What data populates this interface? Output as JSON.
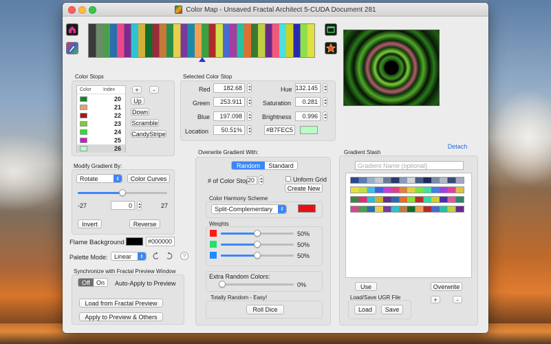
{
  "window": {
    "title": "Color Map - Unsaved Fractal Architect 5-CUDA Document 281"
  },
  "icons": {
    "home": "house-icon",
    "picker": "color-picker-icon",
    "window": "window-icon",
    "favorite": "star-icon",
    "undo": "undo-icon",
    "redo": "redo-icon",
    "help": "help-icon"
  },
  "gradient": {
    "colors": [
      "#3a3a3a",
      "#6a8a6a",
      "#4aa04a",
      "#2a6fb0",
      "#e94a8a",
      "#7b2c8c",
      "#2cc4d0",
      "#d4b03a",
      "#0e6e2a",
      "#9a2a3a",
      "#c47a3a",
      "#2a8e4a",
      "#e8d04a",
      "#7a3a9a",
      "#1a8aa8",
      "#f0a050",
      "#3aa040",
      "#b02a2a",
      "#d0e04a",
      "#4a6ad0",
      "#a040a0",
      "#28c0a0",
      "#e07030",
      "#3a7a30",
      "#c0d040",
      "#6a2a8a",
      "#f05a7a",
      "#4ae0e0",
      "#d0d020",
      "#2a2ab0",
      "#8ee04a",
      "#e0e040"
    ]
  },
  "color_stops": {
    "title": "Color Stops",
    "headers": [
      "Color",
      "Index"
    ],
    "rows": [
      {
        "color": "#0a8a2a",
        "index": "20"
      },
      {
        "color": "#e8a070",
        "index": "21"
      },
      {
        "color": "#a01a1a",
        "index": "22"
      },
      {
        "color": "#7ad030",
        "index": "23"
      },
      {
        "color": "#28e028",
        "index": "24"
      },
      {
        "color": "#c020c0",
        "index": "25"
      },
      {
        "color": "#b7fec5",
        "index": "26"
      }
    ],
    "plus": "+",
    "minus": "-",
    "up": "Up",
    "down": "Down",
    "scramble": "Scramble",
    "candystripe": "CandyStripe"
  },
  "selected_stop": {
    "title": "Selected Color Stop",
    "red_label": "Red",
    "red": "182.68",
    "green_label": "Green",
    "green": "253.911",
    "blue_label": "Blue",
    "blue": "197.098",
    "location_label": "Location",
    "location": "50.51%",
    "hue_label": "Hue",
    "hue": "132.145",
    "saturation_label": "Saturation",
    "saturation": "0.281",
    "brightness_label": "Brightness",
    "brightness": "0.996",
    "hex": "#B7FEC5",
    "swatch": "#b7fec5"
  },
  "modify": {
    "title": "Modify Gradient By:",
    "mode": "Rotate",
    "color_curves": "Color Curves",
    "slider_fraction": 0.5,
    "min": "-27",
    "value": "0",
    "max": "27",
    "invert": "Invert",
    "reverse": "Reverse"
  },
  "flame": {
    "label": "Flame Background",
    "hex": "#000000",
    "swatch": "#000000"
  },
  "palette": {
    "label": "Palette Mode:",
    "mode": "Linear",
    "help": "?"
  },
  "sync": {
    "title": "Synchronize with Fractal Preview Window",
    "off": "Off",
    "on": "On",
    "auto_apply": "Auto-Apply to Preview",
    "load": "Load from Fractal Preview",
    "apply": "Apply to Preview & Others"
  },
  "overwrite": {
    "title": "Overwrite Gradient With:",
    "tab_random": "Random",
    "tab_standard": "Standard",
    "num_stops_label": "# of Color Stops",
    "num_stops": "20",
    "uniform_grid": "Unform Grid",
    "create_new": "Create New",
    "harmony_label": "Color Harmony Scheme",
    "harmony": "Split-Complementary",
    "harmony_color": "#e81010",
    "weights_label": "Weights",
    "weights": [
      {
        "color": "#ff1a1a",
        "value": "50%",
        "fraction": 0.5
      },
      {
        "color": "#22e070",
        "value": "50%",
        "fraction": 0.5
      },
      {
        "color": "#1e8cff",
        "value": "50%",
        "fraction": 0.5
      }
    ],
    "extra_label": "Extra Random Colors:",
    "extra_value": "0%",
    "extra_fraction": 0,
    "easy_label": "Totally Random - Easy!",
    "roll": "Roll Dice"
  },
  "stash": {
    "detach": "Detach",
    "title": "Gradient Stash",
    "placeholder": "Gradient Name (optional)",
    "gradients": [
      [
        "#2a4a8a",
        "#5a7ab0",
        "#9ab0c8",
        "#c0c8d0",
        "#6a7a9a",
        "#2a3a6a",
        "#8a9ab8",
        "#d0d4dc",
        "#4a5a8a",
        "#1a2a5a",
        "#7a8aaa",
        "#b0b8c8",
        "#3a4a7a",
        "#a0a8c0"
      ],
      [
        "#e8e040",
        "#c0e040",
        "#40c0e0",
        "#4060e0",
        "#c040e0",
        "#e04080",
        "#e08040",
        "#e0d040",
        "#80e040",
        "#40e0a0",
        "#4080e0",
        "#a040e0",
        "#e040a0",
        "#e0c040"
      ],
      [
        "#3a8a3a",
        "#e02a7a",
        "#2ac0d0",
        "#d0b02a",
        "#6a2a8a",
        "#2a6ab0",
        "#e0702a",
        "#8ae02a",
        "#c02a2a",
        "#2ae0a0",
        "#d0d02a",
        "#4a2ab0",
        "#e05a9a",
        "#2a8a6a"
      ],
      [
        "#d04a8a",
        "#4aa04a",
        "#2a6fb0",
        "#e8d04a",
        "#7a3a9a",
        "#2cc4d0",
        "#c47a3a",
        "#0e6e2a",
        "#f0a050",
        "#b02a2a",
        "#4a6ad0",
        "#28c0a0",
        "#c0d040",
        "#6a2a8a"
      ]
    ],
    "use": "Use",
    "overwrite": "Overwrite",
    "plus": "+",
    "minus": "-",
    "load_save_label": "Load/Save UGR File",
    "load": "Load",
    "save": "Save"
  }
}
